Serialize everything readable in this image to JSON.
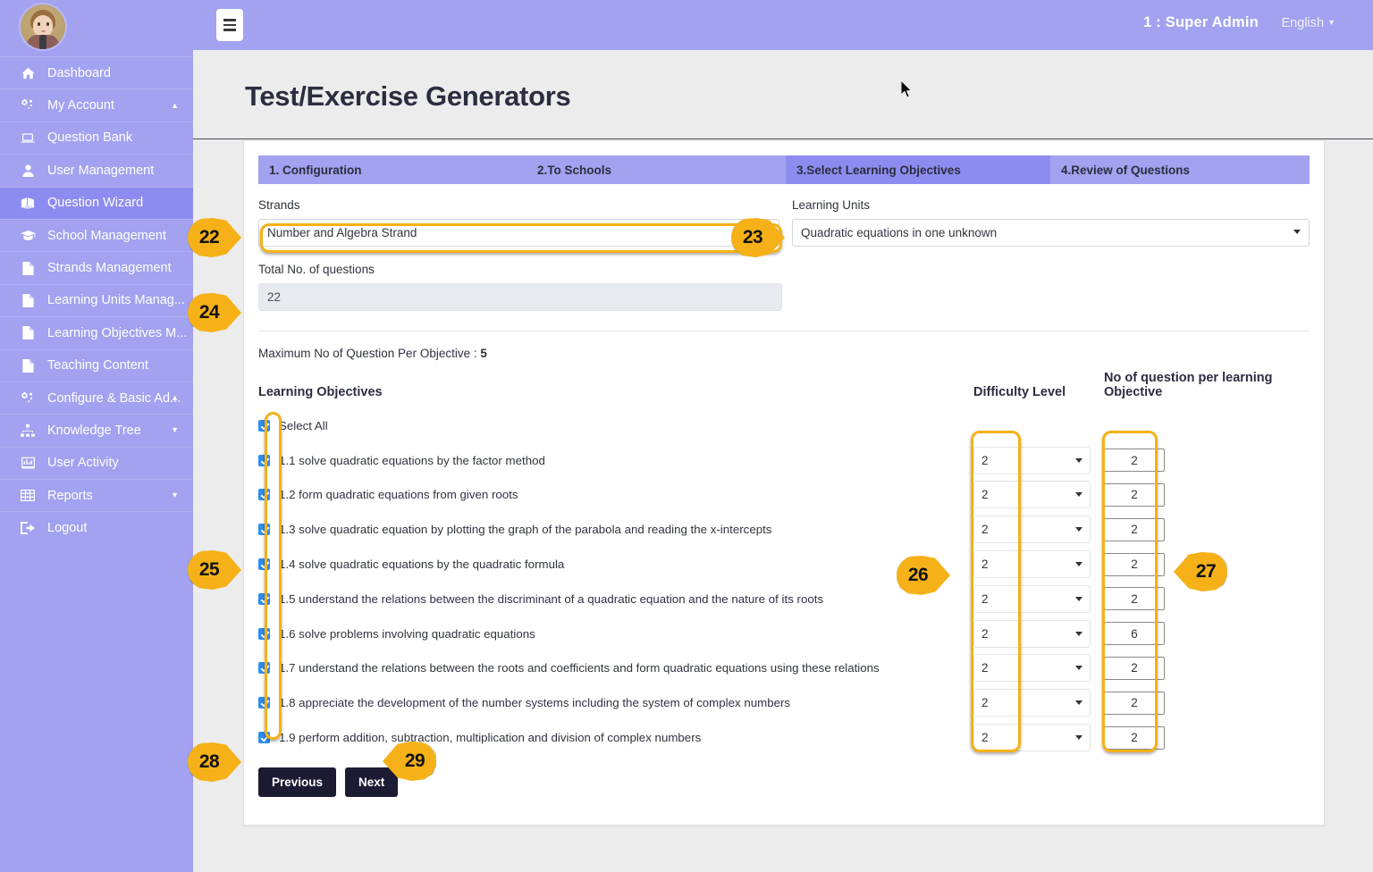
{
  "sidebar": {
    "avatar_name": "user-avatar",
    "items": [
      {
        "label": "Dashboard",
        "icon": "home-icon",
        "caret": ""
      },
      {
        "label": "My Account",
        "icon": "gears-icon",
        "caret": "▲"
      },
      {
        "label": "Question Bank",
        "icon": "laptop-icon",
        "caret": ""
      },
      {
        "label": "User Management",
        "icon": "user-icon",
        "caret": ""
      },
      {
        "label": "Question Wizard",
        "icon": "book-icon",
        "caret": "",
        "active": true
      },
      {
        "label": "School Management",
        "icon": "graduation-cap-icon",
        "caret": ""
      },
      {
        "label": "Strands Management",
        "icon": "file-icon",
        "caret": ""
      },
      {
        "label": "Learning Units Manag...",
        "icon": "file-icon",
        "caret": ""
      },
      {
        "label": "Learning Objectives M...",
        "icon": "file-icon",
        "caret": ""
      },
      {
        "label": "Teaching Content",
        "icon": "file-icon",
        "caret": ""
      },
      {
        "label": "Configure & Basic Ad...",
        "icon": "gears-icon",
        "caret": "▲"
      },
      {
        "label": "Knowledge Tree",
        "icon": "sitemap-icon",
        "caret": "▼"
      },
      {
        "label": "User Activity",
        "icon": "bar-chart-icon",
        "caret": ""
      },
      {
        "label": "Reports",
        "icon": "table-icon",
        "caret": "▼"
      },
      {
        "label": "Logout",
        "icon": "sign-out-icon",
        "caret": ""
      }
    ]
  },
  "topbar": {
    "menu_icon": "hamburger-icon",
    "user": "1 : Super Admin",
    "language": "English",
    "language_caret": "▼"
  },
  "page": {
    "title": "Test/Exercise Generators"
  },
  "wizard": {
    "tabs": [
      {
        "label": "1. Configuration",
        "active": false
      },
      {
        "label": "2.To Schools",
        "active": false
      },
      {
        "label": "3.Select Learning Objectives",
        "active": true
      },
      {
        "label": "4.Review of Questions",
        "active": false
      }
    ]
  },
  "form": {
    "strands_label": "Strands",
    "strands_value": "Number and Algebra Strand",
    "learning_units_label": "Learning Units",
    "learning_units_value": "Quadratic equations in one unknown",
    "total_label": "Total No. of questions",
    "total_value": "22"
  },
  "objectives_section": {
    "max_per_objective_text": "Maximum No of Question Per Objective : ",
    "max_per_objective_value": "5",
    "col_objectives": "Learning Objectives",
    "col_difficulty": "Difficulty Level",
    "col_count": "No of question per learning Objective",
    "select_all_label": "Select All",
    "rows": [
      {
        "label": "1.1 solve quadratic equations by the factor method",
        "checked": true,
        "difficulty": "2",
        "count": "2"
      },
      {
        "label": "1.2 form quadratic equations from given roots",
        "checked": true,
        "difficulty": "2",
        "count": "2"
      },
      {
        "label": "1.3 solve quadratic equation by plotting the graph of the parabola and reading the x-intercepts",
        "checked": true,
        "difficulty": "2",
        "count": "2"
      },
      {
        "label": "1.4 solve quadratic equations by the quadratic formula",
        "checked": true,
        "difficulty": "2",
        "count": "2"
      },
      {
        "label": "1.5 understand the relations between the discriminant of a quadratic equation and the nature of its roots",
        "checked": true,
        "difficulty": "2",
        "count": "2"
      },
      {
        "label": "1.6 solve problems involving quadratic equations",
        "checked": true,
        "difficulty": "2",
        "count": "6"
      },
      {
        "label": "1.7 understand the relations between the roots and coefficients and form quadratic equations using these relations",
        "checked": true,
        "difficulty": "2",
        "count": "2"
      },
      {
        "label": "1.8 appreciate the development of the number systems including the system of complex numbers",
        "checked": true,
        "difficulty": "2",
        "count": "2"
      },
      {
        "label": "1.9 perform addition, subtraction, multiplication and division of complex numbers",
        "checked": true,
        "difficulty": "2",
        "count": "2"
      }
    ]
  },
  "buttons": {
    "previous": "Previous",
    "next": "Next"
  },
  "annotations": {
    "accent_color": "#f5b117",
    "markers": [
      {
        "id": "22",
        "dir": "right"
      },
      {
        "id": "23",
        "dir": "right"
      },
      {
        "id": "24",
        "dir": "right"
      },
      {
        "id": "25",
        "dir": "right"
      },
      {
        "id": "26",
        "dir": "right"
      },
      {
        "id": "27",
        "dir": "left"
      },
      {
        "id": "28",
        "dir": "right"
      },
      {
        "id": "29",
        "dir": "left"
      }
    ]
  },
  "theme": {
    "sidebar_bg": "#a2a2f0",
    "sidebar_active": "#8c8cf0",
    "page_bg": "#ececec",
    "card_bg": "#ffffff",
    "title_color": "#2b2e3f",
    "button_bg": "#1b1b34",
    "checkbox_color": "#2d8cf0"
  }
}
